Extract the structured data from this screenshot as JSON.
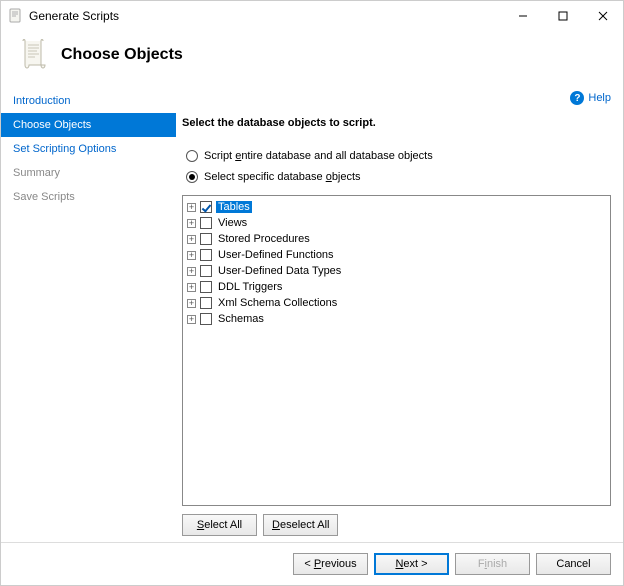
{
  "window": {
    "title": "Generate Scripts"
  },
  "header": {
    "page_title": "Choose Objects"
  },
  "help": {
    "label": "Help"
  },
  "sidebar": {
    "items": [
      {
        "label": "Introduction",
        "active": false,
        "disabled": false
      },
      {
        "label": "Choose Objects",
        "active": true,
        "disabled": false
      },
      {
        "label": "Set Scripting Options",
        "active": false,
        "disabled": false
      },
      {
        "label": "Summary",
        "active": false,
        "disabled": true
      },
      {
        "label": "Save Scripts",
        "active": false,
        "disabled": true
      }
    ]
  },
  "main": {
    "instruction": "Select the database objects to script.",
    "radio_all_pre": "Script ",
    "radio_all_u": "e",
    "radio_all_post": "ntire database and all database objects",
    "radio_specific_pre": "Select specific database ",
    "radio_specific_u": "o",
    "radio_specific_post": "bjects",
    "radio_selected": "specific"
  },
  "tree": {
    "nodes": [
      {
        "label": "Tables",
        "checked": true,
        "selected": true
      },
      {
        "label": "Views",
        "checked": false,
        "selected": false
      },
      {
        "label": "Stored Procedures",
        "checked": false,
        "selected": false
      },
      {
        "label": "User-Defined Functions",
        "checked": false,
        "selected": false
      },
      {
        "label": "User-Defined Data Types",
        "checked": false,
        "selected": false
      },
      {
        "label": "DDL Triggers",
        "checked": false,
        "selected": false
      },
      {
        "label": "Xml Schema Collections",
        "checked": false,
        "selected": false
      },
      {
        "label": "Schemas",
        "checked": false,
        "selected": false
      }
    ]
  },
  "buttons": {
    "select_all_pre": "",
    "select_all_u": "S",
    "select_all_post": "elect All",
    "deselect_all_pre": "",
    "deselect_all_u": "D",
    "deselect_all_post": "eselect All",
    "previous_pre": "< ",
    "previous_u": "P",
    "previous_post": "revious",
    "next_pre": "",
    "next_u": "N",
    "next_post": "ext >",
    "finish_pre": "F",
    "finish_u": "i",
    "finish_post": "nish",
    "cancel": "Cancel"
  }
}
